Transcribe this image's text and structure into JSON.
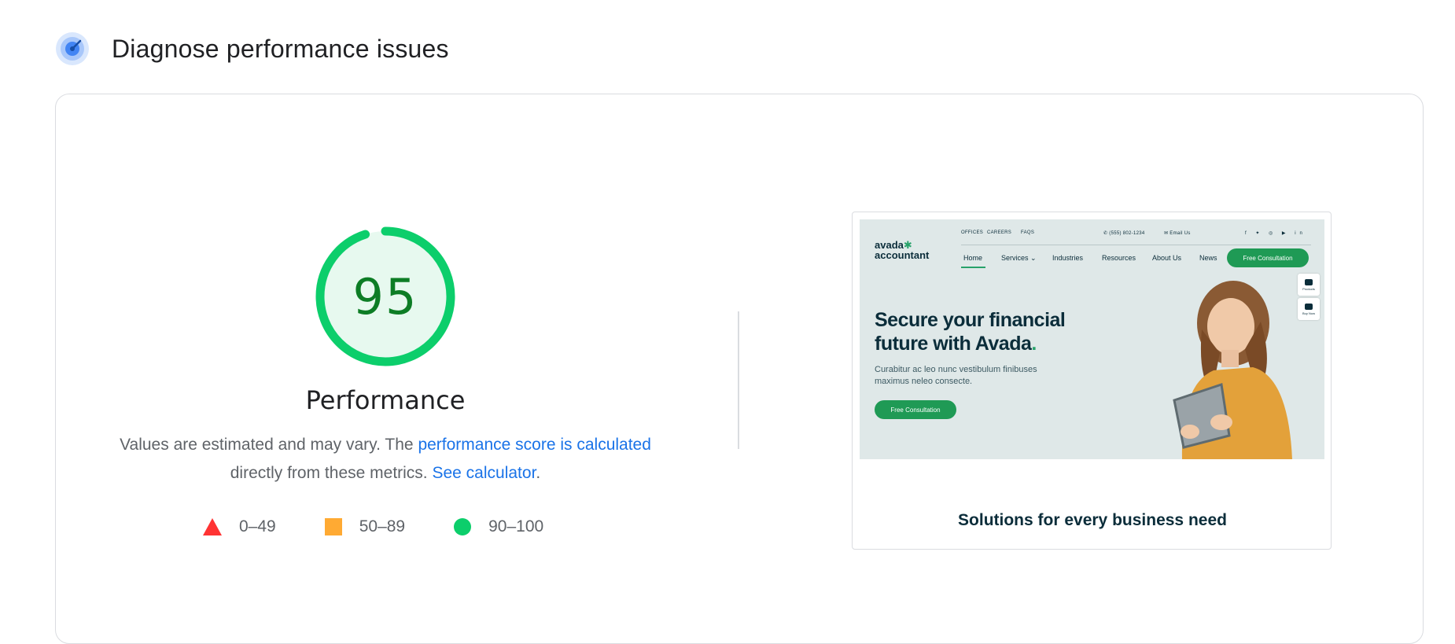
{
  "header": {
    "title": "Diagnose performance issues",
    "icon": "diagnose-icon"
  },
  "gauge": {
    "score": "95",
    "score_value": 95,
    "label": "Performance",
    "color": "#0cce6b",
    "text_color": "#0d7d25"
  },
  "description": {
    "prefix": "Values are estimated and may vary. The ",
    "link1": "performance score is calculated",
    "middle": " directly from these metrics. ",
    "link2": "See calculator",
    "suffix": "."
  },
  "legend": [
    {
      "range": "0–49",
      "shape": "triangle",
      "color": "#ff3333"
    },
    {
      "range": "50–89",
      "shape": "square",
      "color": "#ffaa33"
    },
    {
      "range": "90–100",
      "shape": "circle",
      "color": "#0cce6b"
    }
  ],
  "screenshot": {
    "logo_line1": "avada",
    "logo_line2": "accountant",
    "top_links": [
      "OFFICES",
      "CAREERS",
      "FAQS"
    ],
    "phone": "(555) 802-1234",
    "email": "Email Us",
    "nav": [
      "Home",
      "Services",
      "Industries",
      "Resources",
      "About Us",
      "News"
    ],
    "nav_cta": "Free Consultation",
    "widget1": "Products",
    "widget2": "Buy Now",
    "hero_title": "Secure your financial future with Avada",
    "hero_sub": "Curabitur ac leo nunc vestibulum finibuses maximus neleo consecte.",
    "hero_cta": "Free Consultation",
    "section_heading": "Solutions for every business need"
  }
}
